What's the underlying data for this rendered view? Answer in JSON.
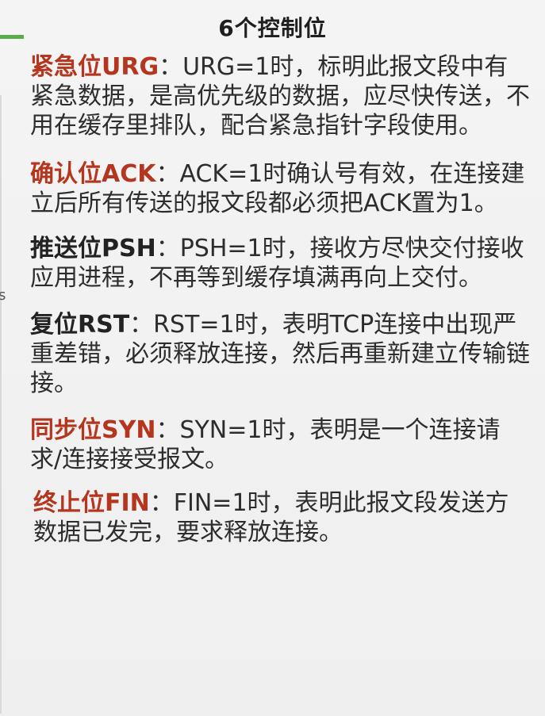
{
  "slide": {
    "title": "6个控制位",
    "items": [
      {
        "label": "紧急位URG",
        "sep": "：",
        "text": "URG=1时，标明此报文段中有紧急数据，是高优先级的数据，应尽快传送，不用在缓存里排队，配合紧急指针字段使用。"
      },
      {
        "label": "确认位ACK",
        "sep": "：",
        "text": "ACK=1时确认号有效，在连接建立后所有传送的报文段都必须把ACK置为1。"
      },
      {
        "label": "推送位PSH",
        "sep": "：",
        "text": "PSH=1时，接收方尽快交付接收应用进程，不再等到缓存填满再向上交付。"
      },
      {
        "label": "复位RST",
        "sep": "：",
        "text": "RST=1时，表明TCP连接中出现严重差错，必须释放连接，然后再重新建立传输链接。"
      },
      {
        "label": "同步位SYN",
        "sep": "：",
        "text": "SYN=1时，表明是一个连接请求/连接接受报文。"
      },
      {
        "label": "终止位FIN",
        "sep": "：",
        "text": "FIN=1时，表明此报文段发送方数据已发完，要求释放连接。"
      }
    ],
    "edge_glyph": "s"
  },
  "colors": {
    "label_red": "#b5361f",
    "label_black": "#222222",
    "accent_green": "#5aae4a"
  }
}
